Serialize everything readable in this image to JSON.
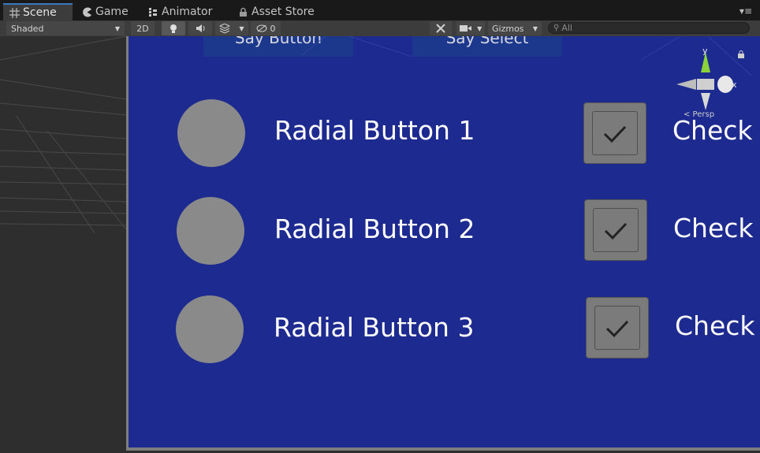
{
  "tabs": [
    {
      "label": "Scene",
      "icon": "grid-icon",
      "active": true
    },
    {
      "label": "Game",
      "icon": "pacman-icon"
    },
    {
      "label": "Animator",
      "icon": "animator-icon"
    },
    {
      "label": "Asset Store",
      "icon": "lock-icon"
    }
  ],
  "toolbar": {
    "shading": "Shaded",
    "mode_2d": "2D",
    "hidden_count": "0",
    "gizmos": "Gizmos",
    "search_placeholder": "All"
  },
  "scene": {
    "top_buttons": [
      "Say Button",
      "Say Select"
    ],
    "radio_buttons": [
      "Radial Button 1",
      "Radial Button 2",
      "Radial Button 3"
    ],
    "checkboxes": [
      "Check",
      "Check",
      "Check"
    ],
    "gizmo": {
      "y_label": "y",
      "x_label": "x",
      "view_label": "< Persp"
    }
  },
  "colors": {
    "canvas": "#1d2a8f",
    "accent": "#3a79bb"
  }
}
